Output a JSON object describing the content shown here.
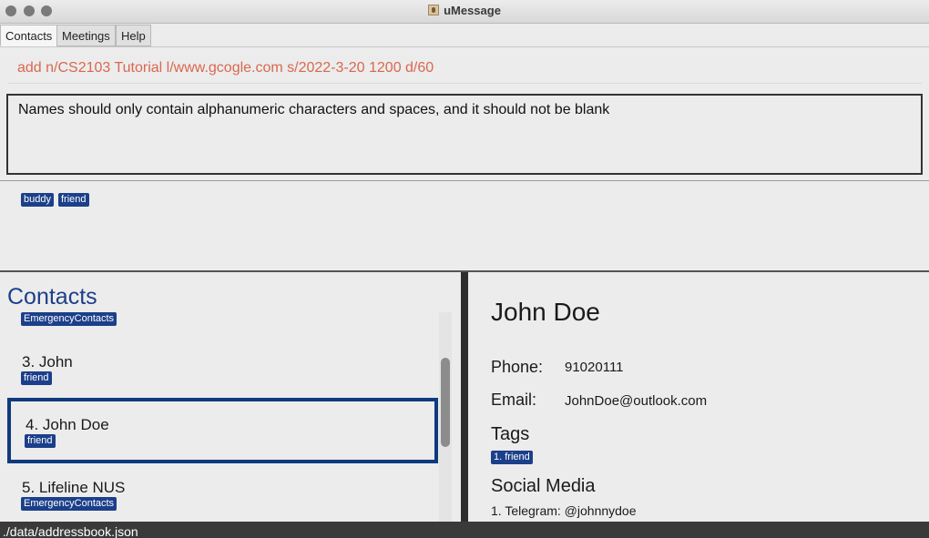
{
  "window": {
    "title": "uMessage",
    "app_icon": "address-book-icon"
  },
  "tabs": [
    {
      "label": "Contacts",
      "active": true
    },
    {
      "label": "Meetings",
      "active": false
    },
    {
      "label": "Help",
      "active": false
    }
  ],
  "command": {
    "value": "add n/CS2103 Tutorial l/www.gcogle.com s/2022-3-20 1200 d/60",
    "color": "#d9684f"
  },
  "result": {
    "message": "Names should only contain alphanumeric characters and spaces, and it should not be blank"
  },
  "tag_filter": [
    "buddy",
    "friend"
  ],
  "contacts": {
    "heading": "Contacts",
    "items": [
      {
        "name": "",
        "tags": [
          "EmergencyContacts"
        ]
      },
      {
        "name": "3.  John",
        "tags": [
          "friend"
        ]
      },
      {
        "name": "4.  John Doe",
        "tags": [
          "friend"
        ],
        "selected": true
      },
      {
        "name": "5.  Lifeline NUS",
        "tags": [
          "EmergencyContacts"
        ]
      }
    ]
  },
  "detail": {
    "name": "John Doe",
    "phone_label": "Phone:",
    "phone": "91020111",
    "email_label": "Email:",
    "email": "JohnDoe@outlook.com",
    "tags_label": "Tags",
    "tags": [
      "1. friend"
    ],
    "social_label": "Social Media",
    "social": [
      "1. Telegram: @johnnydoe"
    ]
  },
  "status": {
    "path": "./data/addressbook.json"
  },
  "colors": {
    "tag_bg": "#1c3f8a",
    "accent": "#1c3f8a",
    "selected_border": "#0f3a7e",
    "statusbar_bg": "#3a3a3a"
  }
}
